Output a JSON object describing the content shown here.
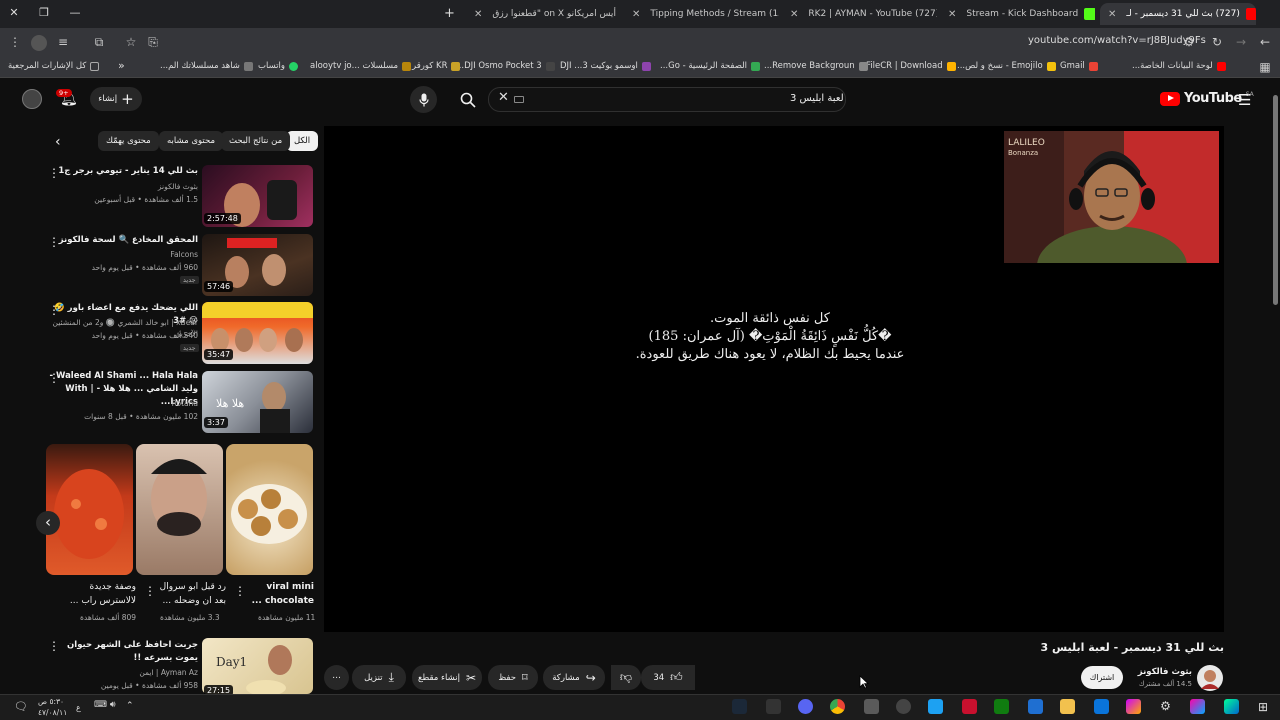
{
  "browser": {
    "tabs": [
      {
        "label": "(727) بث للي 31 ديسمبر - لـ",
        "active": true,
        "favicon_color": "#ff0000"
      },
      {
        "label": "Stream - Kick Dashboard",
        "favicon_color": "#53fc18"
      },
      {
        "label": "(727) RK2 | AYMAN - YouTube",
        "favicon_color": "#ff0000"
      },
      {
        "label": "(13) Tipping Methods / Stream",
        "favicon_color": "#4ec9b0"
      },
      {
        "label": "أيس امريكانو on X \"قطعنوا رزق",
        "favicon_color": "#000000"
      }
    ],
    "new_tab_label": "+",
    "url": "youtube.com/watch?v=rJ8BJudy9Fs",
    "bookmarks": [
      {
        "label": "لوحة البيانات الخاصة...",
        "color": "#ff0000"
      },
      {
        "label": "Gmail",
        "color": "#ea4335"
      },
      {
        "label": "Emojilo - نسخ و لص...",
        "color": "#f4c20d"
      },
      {
        "label": "FileCR | Download",
        "color": "#ffb300"
      },
      {
        "label": "Remove Backgroun...",
        "color": "#888888"
      },
      {
        "label": "الصفحة الرئيسية - Go...",
        "color": "#34a853"
      },
      {
        "label": "اوسمو بوكيت 3... DJI",
        "color": "#8e44ad"
      },
      {
        "label": "DJI Osmo Pocket 3...",
        "color": "#444444"
      },
      {
        "label": "KR كورقر",
        "color": "#c9a227"
      },
      {
        "label": "مسلسلات ...alooytv jo",
        "color": "#b8860b"
      },
      {
        "label": "واتساب",
        "color": "#25d366"
      },
      {
        "label": "شاهد مسلسلاتك الم...",
        "color": "#777777"
      },
      {
        "label": "كل الإشارات المرجعية",
        "color": "#aaaaaa"
      }
    ]
  },
  "youtube": {
    "logo_text": "YouTube",
    "logo_region": "SA",
    "search_query": "لعبة ابليس 3",
    "create_label": "إنشاء",
    "notification_count": "9+",
    "chips": [
      "الكل",
      "من نتائج البحث",
      "محتوى مشابه",
      "محتوى يهمّك"
    ],
    "related": [
      {
        "title": "بث للي 14 يناير - تيومي برجر ج1",
        "channel": "بثوث فالكونز",
        "meta": "1.5 ألف مشاهدة • قبل أسبوعين",
        "duration": "2:57:48",
        "thumb_color": "#6b1e3a"
      },
      {
        "title": "المحقق المخادع 🔍 لسحة فالكونز",
        "channel": "Falcons",
        "meta": "960 ألف مشاهدة • قبل يوم واحد",
        "duration": "57:46",
        "badge": "جديد",
        "thumb_color": "#3a2a20"
      },
      {
        "title": "اللي يضحك يدفع مع اعضاء باور 🤣😢 #3",
        "channel": "xBear | ابو خالد الشمري 🔘 و2 من المنشئين الآخرين",
        "meta": "540 ألف مشاهدة • قبل يوم واحد",
        "duration": "35:47",
        "badge": "جديد",
        "thumb_color": "#d9531e"
      },
      {
        "title": "Waleed Al Shami ... Hala Hala - وليد الشامي ... هلا هلا - | With Lyrics...",
        "channel": "Rotana",
        "meta": "102 مليون مشاهدة • قبل 8 سنوات",
        "duration": "3:37",
        "thumb_color": "#2b2f3a"
      }
    ],
    "shorts": [
      {
        "title": "viral mini chocolate ...",
        "views": "11 مليون مشاهدة",
        "color": "#c9a46a"
      },
      {
        "title": "رد قبل ابو سروال بعد ان وضحله ...",
        "views": "3.3 مليون مشاهدة",
        "color": "#b98a6e"
      },
      {
        "title": "وصفة جديدة لالاسترس راب ...",
        "views": "809 ألف مشاهدة",
        "color": "#c43a1a"
      }
    ],
    "related_last": {
      "title": "جربت احافظ على الشهر حيوان يموت بسرعه !!",
      "channel": "Ayman Az | ايمن",
      "meta": "958 ألف مشاهدة • قبل يومين",
      "duration": "27:15",
      "thumb_color": "#e9d9b0"
    },
    "player": {
      "subtitles": [
        "كل نفس ذائقة الموت.",
        "�كُلُّ نَفْسٍ ذَائِقَةُ الْمَوْتِ� (آل عمران: 185)",
        "عندما يحيط بك الظلام، لا يعود هناك طريق للعودة."
      ],
      "cam_text": "LALILEO\nBonanza"
    },
    "video": {
      "title": "بث للي 31 ديسمبر - لعبة ابليس 3",
      "channel": "بثوث فالكونز",
      "subscribers": "14.5 ألف مشترك",
      "subscribe_label": "اشتراك",
      "likes": "34",
      "share_label": "مشاركة",
      "save_label": "حفظ",
      "clip_label": "إنشاء مقطع",
      "download_label": "تنزيل"
    }
  },
  "taskbar": {
    "time": "٥:٣٠ ص",
    "date": "٤٧/٠٨/١١",
    "lang": "ع"
  }
}
